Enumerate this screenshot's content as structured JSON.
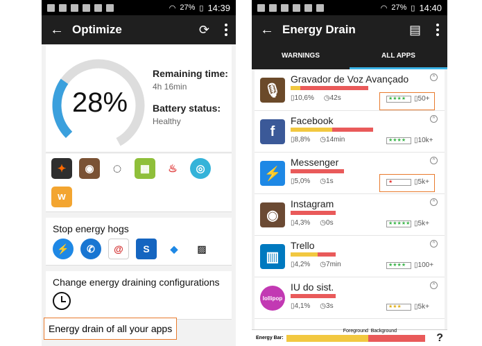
{
  "status": {
    "battery": "27%",
    "time_left": "14:39",
    "time_right": "14:40"
  },
  "optimize": {
    "title": "Optimize",
    "battery_percent": "28%",
    "battery_level": 0.28,
    "remaining_label": "Remaining time:",
    "remaining_value": "4h 16min",
    "status_label": "Battery status:",
    "status_value": "Healthy",
    "stop_hogs": "Stop energy hogs",
    "change_configs": "Change energy draining configurations",
    "energy_all": "Energy drain of all your apps"
  },
  "drain": {
    "title": "Energy Drain",
    "tabs": [
      {
        "label": "WARNINGS"
      },
      {
        "label": "ALL APPS"
      }
    ],
    "apps": [
      {
        "name": "Gravador de Voz Avançado",
        "pct": "10,6%",
        "time": "42s",
        "count": "50+",
        "fg": 0.08,
        "bg": 0.58,
        "stars": "★★★★",
        "color": "#6b4a2a",
        "glyph": "🎙"
      },
      {
        "name": "Facebook",
        "pct": "8,8%",
        "time": "14min",
        "count": "10k+",
        "fg": 0.35,
        "bg": 0.35,
        "stars": "★★★★",
        "color": "#3b5998",
        "glyph": "f"
      },
      {
        "name": "Messenger",
        "pct": "5,0%",
        "time": "1s",
        "count": "5k+",
        "fg": 0.0,
        "bg": 0.45,
        "stars": "★",
        "color": "#1e88e5",
        "glyph": "⚡"
      },
      {
        "name": "Instagram",
        "pct": "4,3%",
        "time": "0s",
        "count": "5k+",
        "fg": 0.0,
        "bg": 0.38,
        "stars": "★★★★★",
        "color": "#6b4a33",
        "glyph": "◉"
      },
      {
        "name": "Trello",
        "pct": "4,2%",
        "time": "7min",
        "count": "100+",
        "fg": 0.23,
        "bg": 0.15,
        "stars": "★★★★",
        "color": "#0079bf",
        "glyph": "▥"
      },
      {
        "name": "IU do sist.",
        "pct": "4,1%",
        "time": "3s",
        "count": "5k+",
        "fg": 0.0,
        "bg": 0.38,
        "stars": "★★★",
        "color": "#c239b3",
        "glyph": "lollipop"
      }
    ],
    "energy_bar_label": "Energy Bar:",
    "foreground_label": "Foreground",
    "background_label": "Background",
    "help": "?"
  }
}
